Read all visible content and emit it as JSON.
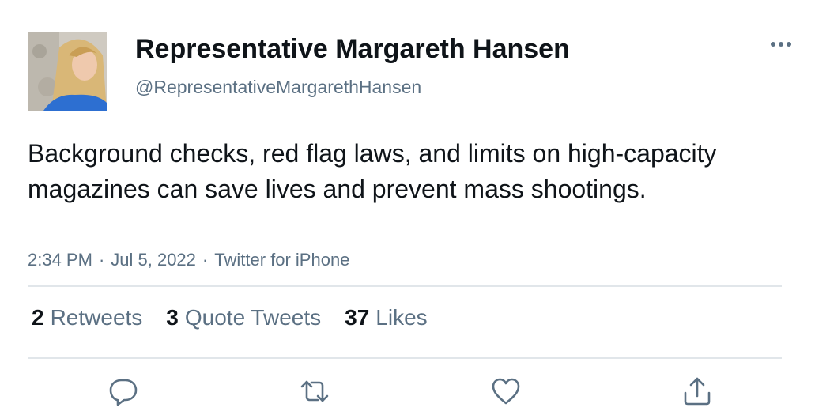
{
  "author": {
    "display_name": "Representative Margareth Hansen",
    "handle": "@RepresentativeMargarethHansen",
    "avatar_icon": "profile-photo"
  },
  "tweet": {
    "text": "Background checks, red flag laws, and limits on high-capacity magazines can save lives and prevent mass shootings.",
    "time": "2:34 PM",
    "date": "Jul 5, 2022",
    "source": "Twitter for iPhone",
    "separator": "·"
  },
  "stats": {
    "retweets": {
      "count": "2",
      "label": "Retweets"
    },
    "quote_tweets": {
      "count": "3",
      "label": "Quote Tweets"
    },
    "likes": {
      "count": "37",
      "label": "Likes"
    }
  },
  "actions": [
    "reply-icon",
    "retweet-icon",
    "like-icon",
    "share-icon"
  ],
  "colors": {
    "text": "#0f1419",
    "secondary": "#5b7083",
    "divider": "#e1e6ea",
    "icon": "#5b7083"
  }
}
